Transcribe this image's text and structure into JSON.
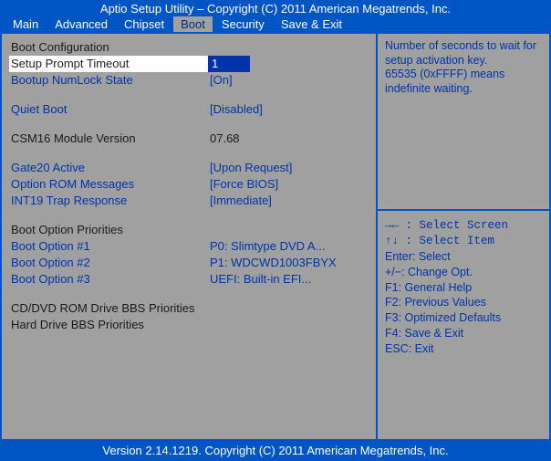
{
  "header": {
    "title": "Aptio Setup Utility – Copyright (C) 2011 American Megatrends, Inc."
  },
  "menubar": {
    "tabs": [
      {
        "label": "Main"
      },
      {
        "label": "Advanced"
      },
      {
        "label": "Chipset"
      },
      {
        "label": "Boot"
      },
      {
        "label": "Security"
      },
      {
        "label": "Save & Exit"
      }
    ],
    "selected_index": 3
  },
  "left": {
    "section_boot_cfg": "Boot Configuration",
    "setup_prompt_timeout": {
      "label": "Setup Prompt Timeout",
      "value": "1"
    },
    "bootup_numlock": {
      "label": "Bootup NumLock State",
      "value": "[On]"
    },
    "quiet_boot": {
      "label": "Quiet Boot",
      "value": "[Disabled]"
    },
    "csm16": {
      "label": "CSM16 Module Version",
      "value": "07.68"
    },
    "gate20": {
      "label": "Gate20 Active",
      "value": "[Upon Request]"
    },
    "oprom": {
      "label": "Option ROM Messages",
      "value": "[Force BIOS]"
    },
    "int19": {
      "label": "INT19 Trap Response",
      "value": "[Immediate]"
    },
    "section_boot_prio": "Boot Option Priorities",
    "boot1": {
      "label": "Boot Option #1",
      "value": "P0: Slimtype DVD A..."
    },
    "boot2": {
      "label": "Boot Option #2",
      "value": "P1: WDCWD1003FBYX"
    },
    "boot3": {
      "label": "Boot Option #3",
      "value": "UEFI: Built-in EFI..."
    },
    "cd_bbs": "CD/DVD ROM Drive BBS Priorities",
    "hd_bbs": "Hard Drive BBS Priorities"
  },
  "help": {
    "item_help": "Number of seconds to wait for setup activation key.\n65535 (0xFFFF) means indefinite waiting.",
    "keys": {
      "select_screen": "→← : Select Screen",
      "select_item": "↑↓ : Select Item",
      "enter": "Enter: Select",
      "change": "+/−: Change Opt.",
      "f1": "F1: General Help",
      "f2": "F2: Previous Values",
      "f3": "F3: Optimized Defaults",
      "f4": "F4: Save & Exit",
      "esc": "ESC: Exit"
    }
  },
  "footer": {
    "text": "Version 2.14.1219. Copyright (C) 2011 American Megatrends, Inc."
  }
}
